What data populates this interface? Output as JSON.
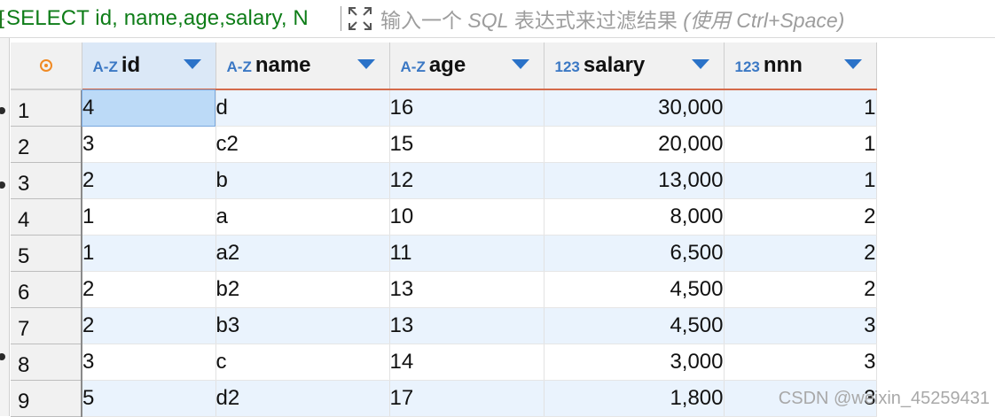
{
  "filter": {
    "sql": "SELECT id, name,age,salary, N",
    "hint_prefix": "输入一个",
    "hint_sql": "SQL",
    "hint_middle": "表达式来过滤结果",
    "hint_suffix": "(使用 Ctrl+Space)"
  },
  "columns": [
    {
      "type": "A-Z",
      "name": "id"
    },
    {
      "type": "A-Z",
      "name": "name"
    },
    {
      "type": "A-Z",
      "name": "age"
    },
    {
      "type": "123",
      "name": "salary"
    },
    {
      "type": "123",
      "name": "nnn"
    }
  ],
  "rows": [
    {
      "n": "1",
      "id": "4",
      "name": "d",
      "age": "16",
      "salary": "30,000",
      "nnn": "1"
    },
    {
      "n": "2",
      "id": "3",
      "name": "c2",
      "age": "15",
      "salary": "20,000",
      "nnn": "1"
    },
    {
      "n": "3",
      "id": "2",
      "name": "b",
      "age": "12",
      "salary": "13,000",
      "nnn": "1"
    },
    {
      "n": "4",
      "id": "1",
      "name": "a",
      "age": "10",
      "salary": "8,000",
      "nnn": "2"
    },
    {
      "n": "5",
      "id": "1",
      "name": "a2",
      "age": "11",
      "salary": "6,500",
      "nnn": "2"
    },
    {
      "n": "6",
      "id": "2",
      "name": "b2",
      "age": "13",
      "salary": "4,500",
      "nnn": "2"
    },
    {
      "n": "7",
      "id": "2",
      "name": "b3",
      "age": "13",
      "salary": "4,500",
      "nnn": "3"
    },
    {
      "n": "8",
      "id": "3",
      "name": "c",
      "age": "14",
      "salary": "3,000",
      "nnn": "3"
    },
    {
      "n": "9",
      "id": "5",
      "name": "d2",
      "age": "17",
      "salary": "1,800",
      "nnn": "3"
    }
  ],
  "watermark": "CSDN @weixin_45259431",
  "colors": {
    "sql_text": "#0e7d18",
    "type_label": "#3b78c4",
    "header_underline": "#d46a4a",
    "row_alt": "#eaf3fd"
  }
}
